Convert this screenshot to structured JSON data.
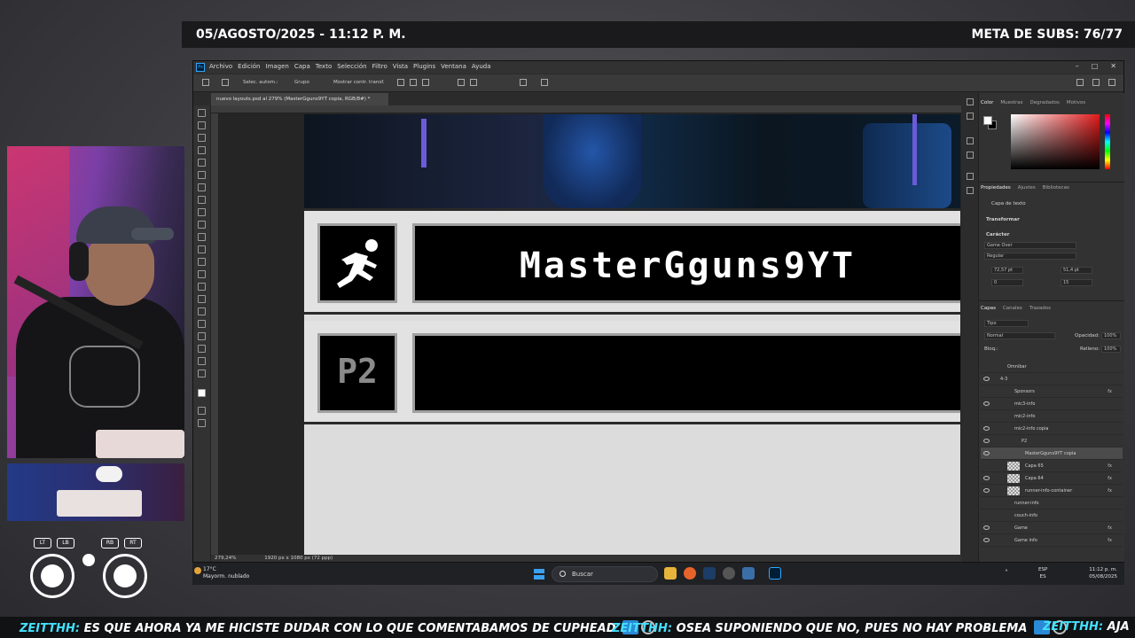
{
  "overlay": {
    "date_time": "05/AGOSTO/2025 - 11:12 P. M.",
    "subs_goal": "META DE SUBS: 76/77"
  },
  "controller": {
    "lt": "LT",
    "lb": "LB",
    "rb": "RB",
    "rt": "RT"
  },
  "photoshop": {
    "logo": "Ps",
    "menu": [
      "Archivo",
      "Edición",
      "Imagen",
      "Capa",
      "Texto",
      "Selección",
      "Filtro",
      "Vista",
      "Plugins",
      "Ventana",
      "Ayuda"
    ],
    "options": {
      "auto_select": "Selec. autom.:",
      "group": "Grupo",
      "show_transform": "Mostrar contr. transf."
    },
    "doc_tab": "nuevo layouts.psd al 279% (MasterGguns9YT copia, RGB/8#) *",
    "status": {
      "zoom": "279,24%",
      "size": "1920 px x 1080 px (72 ppp)"
    }
  },
  "canvas": {
    "player1_name": "MasterGguns9YT",
    "player2_label": "P2"
  },
  "panels": {
    "color_tabs": [
      "Color",
      "Muestras",
      "Degradados",
      "Motivos"
    ],
    "prop_tabs": [
      "Propiedades",
      "Ajustes",
      "Bibliotecas"
    ],
    "layer_kind": "Capa de texto",
    "transform": "Transformar",
    "character": "Carácter",
    "font_family": "Game Over",
    "font_style": "Regular",
    "font_size": "72,57 pt",
    "leading": "51,4 pt",
    "kerning": "0",
    "tracking": "15",
    "layers_tabs": [
      "Capas",
      "Canales",
      "Trazados"
    ],
    "filter": "Tipo",
    "blend": "Normal",
    "opacity_label": "Opacidad:",
    "opacity": "100%",
    "lock_label": "Bloq.:",
    "fill_label": "Relleno:",
    "fill": "100%",
    "layers": [
      {
        "name": "Omnibar",
        "fx": false
      },
      {
        "name": "4-3",
        "fx": false
      },
      {
        "name": "Sponsors",
        "fx": true
      },
      {
        "name": "mic3-info",
        "fx": false
      },
      {
        "name": "mic2-info",
        "fx": false
      },
      {
        "name": "mic2-info copia",
        "fx": false
      },
      {
        "name": "P2",
        "fx": false
      },
      {
        "name": "MasterGguns9YT copia",
        "fx": false
      },
      {
        "name": "Capa 65",
        "fx": true
      },
      {
        "name": "Capa 64",
        "fx": true
      },
      {
        "name": "runner-info-container",
        "fx": true
      },
      {
        "name": "runner-info",
        "fx": false
      },
      {
        "name": "couch-info",
        "fx": false
      },
      {
        "name": "Game",
        "fx": true
      },
      {
        "name": "Game info",
        "fx": true
      }
    ]
  },
  "taskbar": {
    "temp": "17°C",
    "weather": "Mayorm. nublado",
    "search": "Buscar",
    "lang1": "ESP",
    "lang2": "ES",
    "time": "11:12 p. m.",
    "date": "05/08/2025"
  },
  "chat": [
    {
      "user": "ZEITTHH:",
      "text": "ES QUE AHORA YA ME HICISTE DUDAR CON LO QUE COMENTABAMOS DE CUPHEAD"
    },
    {
      "user": "ZEITTHH:",
      "text": "OSEA SUPONIENDO QUE NO, PUES NO HAY PROBLEMA"
    },
    {
      "user": "ZEITTHH:",
      "text": "AJA"
    }
  ]
}
